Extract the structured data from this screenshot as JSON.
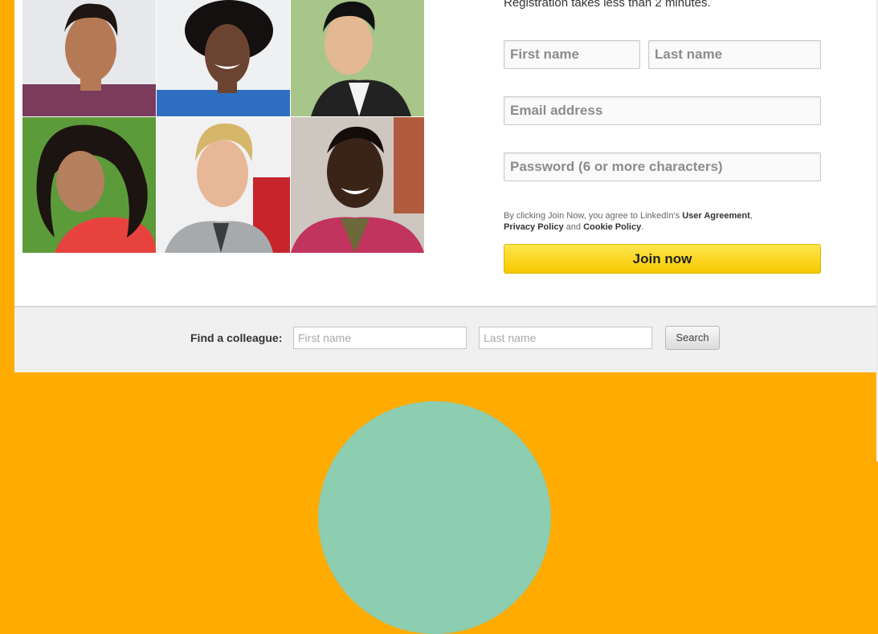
{
  "signup": {
    "registration_note": "Registration takes less than 2 minutes.",
    "first_name_placeholder": "First name",
    "last_name_placeholder": "Last name",
    "email_placeholder": "Email address",
    "password_placeholder": "Password (6 or more characters)",
    "legal_prefix": "By clicking Join Now, you agree to LinkedIn's ",
    "user_agreement": "User Agreement",
    "legal_sep": ",",
    "privacy_policy": "Privacy Policy",
    "legal_and": " and ",
    "cookie_policy": "Cookie Policy",
    "legal_end": ".",
    "join_label": "Join now"
  },
  "find_colleague": {
    "label": "Find a colleague:",
    "first_name_placeholder": "First name",
    "last_name_placeholder": "Last name",
    "search_label": "Search"
  },
  "colors": {
    "background": "#ffab00",
    "join_button": "#f6c800",
    "circle": "#8dcdb0"
  }
}
